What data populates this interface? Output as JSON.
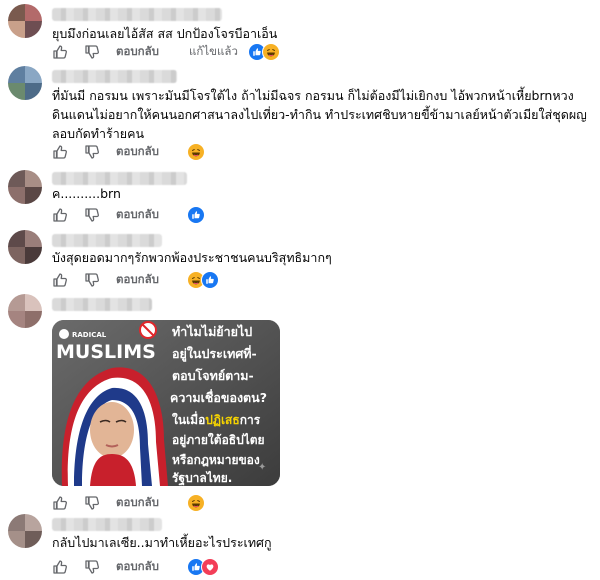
{
  "comments": [
    {
      "text": "ยุบมึงก่อนเลยไอ้สัส สส ปกป้องโจรบีอาเอ็น",
      "reply_label": "ตอบกลับ",
      "edited_label": "แก้ไขแล้ว",
      "reactions": [
        "like-icon",
        "haha-icon"
      ]
    },
    {
      "text": "ที่มันมี กอรมน เพราะมันมีโจรใต้ไง ถ้าไม่มีฉจร กอรมน ก็ไม่ต้องมีไม่เยิกงบ ไอ้พวกหน้าเหี้ยbrnหวงดินแดนไม่อยากให้คนนอกศาสนาลงไปเที่ยว-ทำกิน ทำประเทศชิบหายขี้ข้ามาเลย์หน้าตัวเมียใส่ชุดผญ ลอบกัดทำร้ายคน",
      "reply_label": "ตอบกลับ",
      "reactions": [
        "haha-icon"
      ]
    },
    {
      "text": "ค..........brn",
      "reply_label": "ตอบกลับ",
      "reactions": [
        "like-icon"
      ]
    },
    {
      "text": "บังสุดยอดมากๆรักพวกพ้องประชาชนคนบริสุทธิมากๆ",
      "reply_label": "ตอบกลับ",
      "reactions": [
        "haha-icon",
        "like-icon"
      ]
    },
    {
      "reply_label": "ตอบกลับ",
      "reactions": [
        "haha-icon"
      ],
      "image": {
        "logo_top": "RADICAL",
        "logo_main": "MUSLIMS",
        "headline_lines": [
          "ทำไมไม่ย้ายไป",
          "อยู่ในประเทศที่-",
          "ตอบโจทย์ตาม-",
          "ความเชื่อของตน?"
        ],
        "body_pre": "ในเมื่อ",
        "body_highlight": "ปฏิเสธ",
        "body_post": "การ",
        "body_lines": [
          "อยู่ภายใต้อธิปไตย",
          "หรือกฎหมายของ",
          "รัฐบาลไทย."
        ]
      }
    },
    {
      "text": "กลับไปมาเลเซีย..มาทำเหี้ยอะไรประเทศกู",
      "reply_label": "ตอบกลับ",
      "reactions": [
        "like-icon",
        "love-icon"
      ]
    }
  ],
  "colors": {
    "like": "#1877f2",
    "haha": "#f7b125",
    "love": "#f33e58",
    "meta_text": "#65676b",
    "highlight": "#f5d300"
  }
}
